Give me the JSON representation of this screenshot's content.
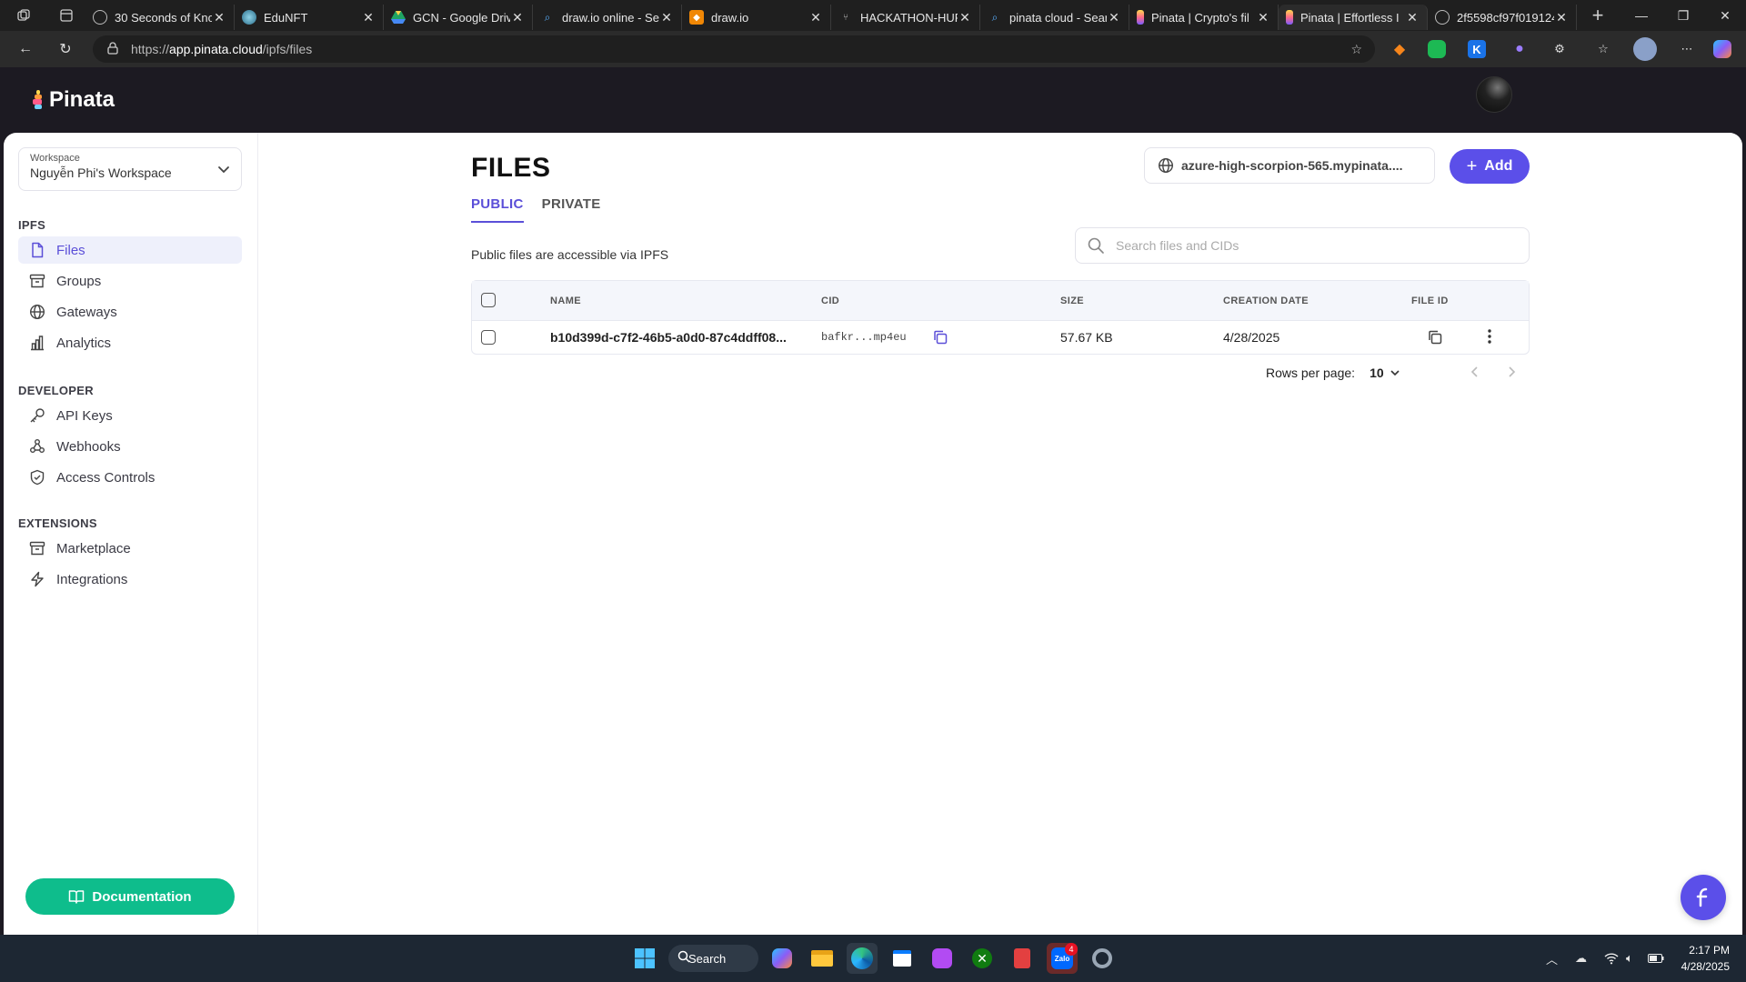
{
  "browser": {
    "tabs": [
      {
        "title": "30 Seconds of Kno",
        "favicon": "globe-icon"
      },
      {
        "title": "EduNFT",
        "favicon": "edunft-icon"
      },
      {
        "title": "GCN - Google Driv",
        "favicon": "drive-icon"
      },
      {
        "title": "draw.io online - Se",
        "favicon": "search-icon"
      },
      {
        "title": "draw.io",
        "favicon": "drawio-icon"
      },
      {
        "title": "HACKATHON-HUF",
        "favicon": "github-icon"
      },
      {
        "title": "pinata cloud - Sear",
        "favicon": "search-icon"
      },
      {
        "title": "Pinata | Crypto's fil",
        "favicon": "pinata-icon"
      },
      {
        "title": "Pinata | Effortless I",
        "favicon": "pinata-icon"
      },
      {
        "title": "2f5598cf97f019124",
        "favicon": "globe-icon"
      }
    ],
    "active_tab_index": 8,
    "url_scheme": "https://",
    "url_host": "app.pinata.cloud",
    "url_path": "/ipfs/files"
  },
  "app": {
    "brand": "Pinata",
    "accent_color": "#5b4fe9",
    "doc_button_color": "#0ebd8c"
  },
  "sidebar": {
    "workspace_label": "Workspace",
    "workspace_name": "Nguyễn Phi's Workspace",
    "sections": [
      {
        "title": "IPFS",
        "items": [
          {
            "label": "Files",
            "icon": "file-icon",
            "active": true
          },
          {
            "label": "Groups",
            "icon": "archive-icon"
          },
          {
            "label": "Gateways",
            "icon": "globe-icon"
          },
          {
            "label": "Analytics",
            "icon": "bar-chart-icon"
          }
        ]
      },
      {
        "title": "DEVELOPER",
        "items": [
          {
            "label": "API Keys",
            "icon": "key-icon"
          },
          {
            "label": "Webhooks",
            "icon": "webhook-icon"
          },
          {
            "label": "Access Controls",
            "icon": "shield-icon"
          }
        ]
      },
      {
        "title": "EXTENSIONS",
        "items": [
          {
            "label": "Marketplace",
            "icon": "archive-icon"
          },
          {
            "label": "Integrations",
            "icon": "lightning-icon"
          }
        ]
      }
    ],
    "documentation_label": "Documentation"
  },
  "main": {
    "title": "FILES",
    "gateway": "azure-high-scorpion-565.mypinata....",
    "add_label": "Add",
    "tabs": [
      {
        "label": "PUBLIC",
        "active": true
      },
      {
        "label": "PRIVATE",
        "active": false
      }
    ],
    "description": "Public files are accessible via IPFS",
    "search_placeholder": "Search files and CIDs",
    "table": {
      "columns": [
        "NAME",
        "CID",
        "SIZE",
        "CREATION DATE",
        "FILE ID"
      ],
      "rows": [
        {
          "name": "b10d399d-c7f2-46b5-a0d0-87c4ddff08...",
          "cid": "bafkr...mp4eu",
          "size": "57.67 KB",
          "created": "4/28/2025"
        }
      ]
    },
    "rows_per_page_label": "Rows per page:",
    "rows_per_page_value": "10"
  },
  "taskbar": {
    "search_label": "Search",
    "zalo_badge": "4",
    "time": "2:17 PM",
    "date": "4/28/2025"
  }
}
